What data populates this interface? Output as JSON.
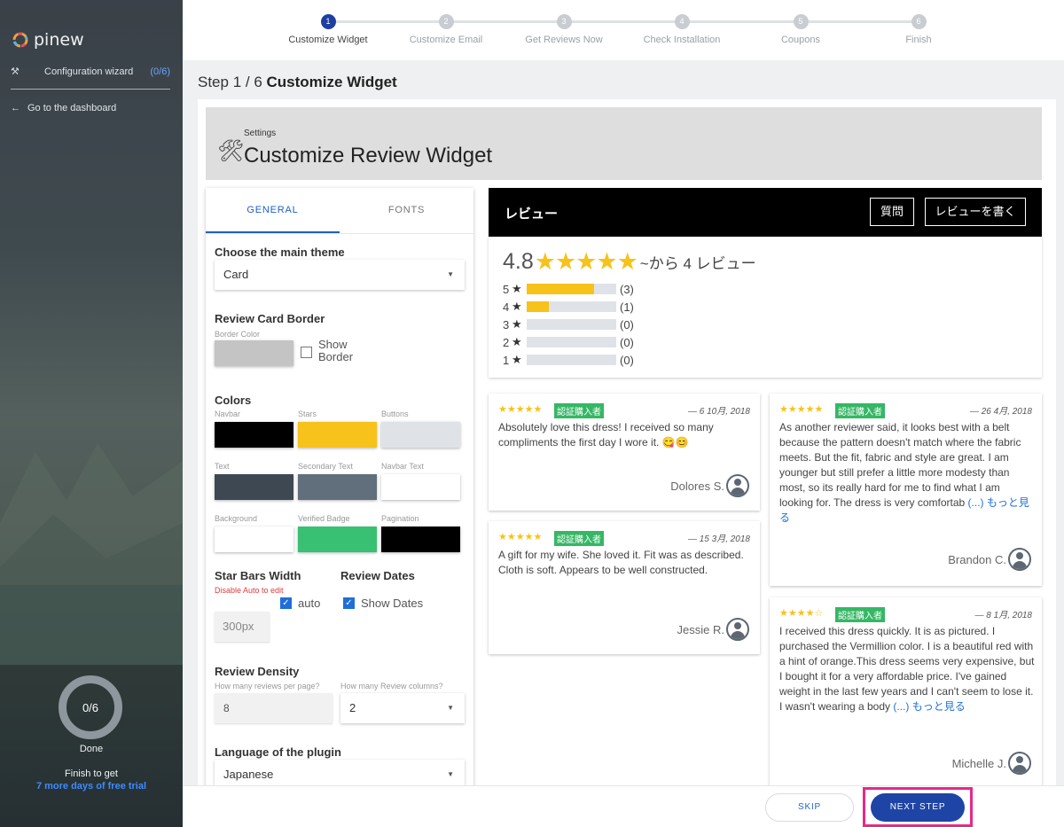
{
  "brand": {
    "name": "pinew"
  },
  "sidebar": {
    "wizard_label": "Configuration wizard",
    "wizard_count": "(0/6)",
    "dashboard_link": "Go to the dashboard",
    "progress": "0/6",
    "progress_label": "Done",
    "finish_line1": "Finish to get",
    "finish_line2": "7 more days of free trial"
  },
  "stepper": [
    {
      "num": "1",
      "label": "Customize Widget",
      "active": true
    },
    {
      "num": "2",
      "label": "Customize Email",
      "active": false
    },
    {
      "num": "3",
      "label": "Get Reviews Now",
      "active": false
    },
    {
      "num": "4",
      "label": "Check Installation",
      "active": false
    },
    {
      "num": "5",
      "label": "Coupons",
      "active": false
    },
    {
      "num": "6",
      "label": "Finish",
      "active": false
    }
  ],
  "page_heading": {
    "prefix": "Step 1 / 6",
    "title": "Customize Widget"
  },
  "settings": {
    "small": "Settings",
    "title": "Customize Review Widget"
  },
  "tabs": {
    "general": "GENERAL",
    "fonts": "FONTS"
  },
  "theme": {
    "label": "Choose the main theme",
    "value": "Card"
  },
  "border": {
    "label": "Review Card Border",
    "color_label": "Border Color",
    "show_label": "Show Border",
    "show_checked": false,
    "color": "#c4c4c4"
  },
  "colors": {
    "label": "Colors",
    "swatches": [
      {
        "name": "Navbar",
        "color": "#000000"
      },
      {
        "name": "Stars",
        "color": "#f7c21a"
      },
      {
        "name": "Buttons",
        "color": "#dfe3e8"
      },
      {
        "name": "Text",
        "color": "#3d4852"
      },
      {
        "name": "Secondary Text",
        "color": "#606f7b"
      },
      {
        "name": "Navbar Text",
        "color": "#ffffff"
      },
      {
        "name": "Background",
        "color": "#ffffff"
      },
      {
        "name": "Verified Badge",
        "color": "#38c172"
      },
      {
        "name": "Pagination",
        "color": "#000000"
      }
    ]
  },
  "star_bars": {
    "label": "Star Bars Width",
    "note": "Disable Auto to edit",
    "auto_label": "auto",
    "auto_checked": true,
    "value": "300px"
  },
  "review_dates": {
    "label": "Review Dates",
    "show_label": "Show Dates",
    "checked": true
  },
  "density": {
    "label": "Review Density",
    "per_page_label": "How many reviews per page?",
    "per_page": "8",
    "columns_label": "How many Review columns?",
    "columns": "2"
  },
  "language": {
    "label": "Language of the plugin",
    "value": "Japanese"
  },
  "widget": {
    "title": "レビュー",
    "ask_button": "質問",
    "write_button": "レビューを書く",
    "average": "4.8",
    "average_stars": "★★★★★",
    "count_text": "~から 4 レビュー",
    "bars": [
      {
        "star": "5",
        "count": "(3)",
        "fraction": 0.75
      },
      {
        "star": "4",
        "count": "(1)",
        "fraction": 0.25
      },
      {
        "star": "3",
        "count": "(0)",
        "fraction": 0
      },
      {
        "star": "2",
        "count": "(0)",
        "fraction": 0
      },
      {
        "star": "1",
        "count": "(0)",
        "fraction": 0
      }
    ],
    "verified_badge": "認証購入者",
    "more_link": "もっと見る",
    "reviews": [
      {
        "stars": "★★★★★",
        "date": "— 6 10月, 2018",
        "text": "Absolutely love this dress! I received so many compliments the first day I wore it. 😋😊",
        "author": "Dolores S."
      },
      {
        "stars": "★★★★★",
        "date": "— 15 3月, 2018",
        "text": "A gift for my wife. She loved it. Fit was as described. Cloth is soft. Appears to be well constructed.",
        "author": "Jessie R."
      },
      {
        "stars": "★★★★★",
        "date": "— 26 4月, 2018",
        "text": "As another reviewer said, it looks best with a belt because the pattern doesn't match where the fabric meets. But the fit, fabric and style are great. I am younger but still prefer a little more modesty than most, so its really hard for me to find what I am looking for. The dress is very comfortab",
        "ellipsis": "(...)",
        "author": "Brandon C."
      },
      {
        "stars": "★★★★☆",
        "date": "— 8 1月, 2018",
        "text": "I received this dress quickly. It is as pictured. I purchased the Vermillion color. I is a beautiful red with a hint of orange.This dress seems very expensive, but I bought it for a very affordable price. I've gained weight in the last few years and I can't seem to lose it. I wasn't wearing a body",
        "ellipsis": "(...)",
        "author": "Michelle J."
      }
    ]
  },
  "footer": {
    "skip": "SKIP",
    "next": "NEXT STEP"
  }
}
